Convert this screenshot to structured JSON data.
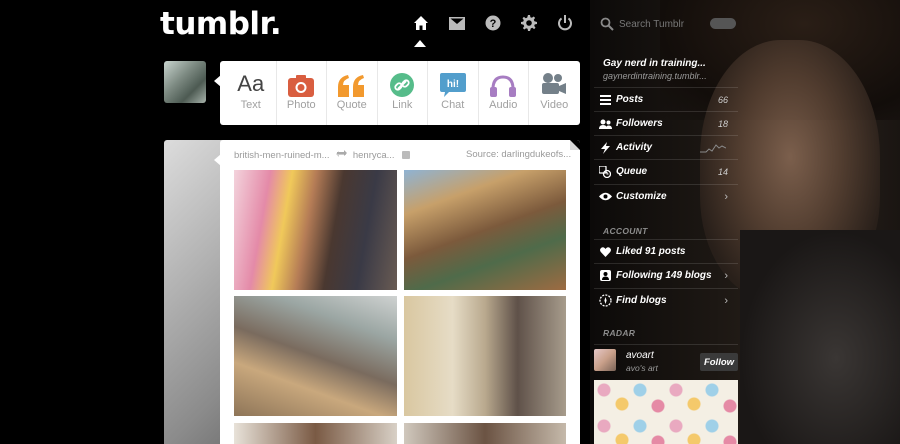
{
  "app": {
    "logo": "tumblr."
  },
  "nav": {
    "items": [
      {
        "icon": "home-icon",
        "label": "Dashboard",
        "active": true
      },
      {
        "icon": "mail-icon",
        "label": "Messages"
      },
      {
        "icon": "help-icon",
        "label": "Help"
      },
      {
        "icon": "gear-icon",
        "label": "Settings"
      },
      {
        "icon": "power-icon",
        "label": "Log out"
      }
    ]
  },
  "post_types": [
    {
      "label": "Text",
      "icon": "text-icon",
      "color": "#444444"
    },
    {
      "label": "Photo",
      "icon": "camera-icon",
      "color": "#d95e40"
    },
    {
      "label": "Quote",
      "icon": "quote-icon",
      "color": "#f2992e"
    },
    {
      "label": "Link",
      "icon": "link-icon",
      "color": "#56bc8a"
    },
    {
      "label": "Chat",
      "icon": "chat-icon",
      "color": "#529ecc"
    },
    {
      "label": "Audio",
      "icon": "headphones-icon",
      "color": "#a77dc2"
    },
    {
      "label": "Video",
      "icon": "video-camera-icon",
      "color": "#748089"
    }
  ],
  "post": {
    "blog": "british-men-ruined-m...",
    "reblogged_from": "henryca...",
    "source": "Source: darlingdukeofs..."
  },
  "search": {
    "placeholder": "Search Tumblr"
  },
  "blog": {
    "name": "Gay nerd in training...",
    "url": "gaynerdintraining.tumblr..."
  },
  "sidebar": {
    "rows": [
      {
        "label": "Posts",
        "value": "66",
        "icon": "posts-icon"
      },
      {
        "label": "Followers",
        "value": "18",
        "icon": "followers-icon"
      },
      {
        "label": "Activity",
        "value": "",
        "icon": "activity-icon"
      },
      {
        "label": "Queue",
        "value": "14",
        "icon": "queue-icon"
      },
      {
        "label": "Customize",
        "value": "",
        "icon": "eye-icon"
      }
    ],
    "account_label": "ACCOUNT",
    "account_rows": [
      {
        "label": "Liked 91 posts",
        "icon": "heart-icon"
      },
      {
        "label": "Following 149 blogs",
        "icon": "following-icon"
      },
      {
        "label": "Find blogs",
        "icon": "compass-icon"
      }
    ],
    "radar_label": "RADAR",
    "radar": {
      "name": "avoart",
      "sub": "avo's art",
      "button": "Follow"
    }
  }
}
